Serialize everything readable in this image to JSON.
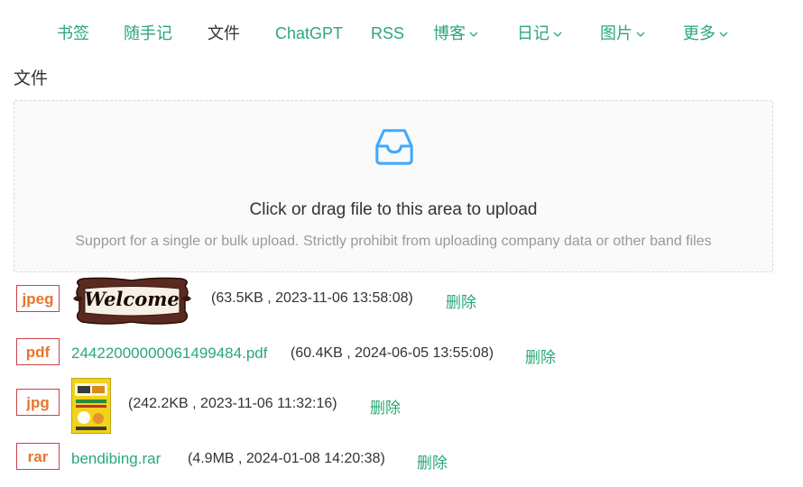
{
  "nav": {
    "items": [
      {
        "label": "书签"
      },
      {
        "label": "随手记"
      },
      {
        "label": "文件"
      },
      {
        "label": "ChatGPT"
      },
      {
        "label": "RSS"
      },
      {
        "label": "博客"
      },
      {
        "label": "日记"
      },
      {
        "label": "图片"
      },
      {
        "label": "更多"
      }
    ],
    "active_index": 2
  },
  "page": {
    "title": "文件"
  },
  "upload": {
    "icon": "inbox-icon",
    "hint": "Click or drag file to this area to upload",
    "sub": "Support for a single or bulk upload. Strictly prohibit from uploading company data or other band files"
  },
  "files": [
    {
      "type": "jpeg",
      "thumb_text": "Welcome",
      "meta": "(63.5KB , 2023-11-06 13:58:08)",
      "delete": "删除"
    },
    {
      "type": "pdf",
      "name": "24422000000061499484.pdf",
      "meta": "(60.4KB , 2024-06-05 13:55:08)",
      "delete": "删除"
    },
    {
      "type": "jpg",
      "meta": "(242.2KB , 2023-11-06 11:32:16)",
      "delete": "删除"
    },
    {
      "type": "rar",
      "name": "bendibing.rar",
      "meta": "(4.9MB , 2024-01-08 14:20:38)",
      "delete": "删除"
    }
  ],
  "colors": {
    "accent": "#2aa876",
    "badge_border": "#c8434a",
    "badge_text": "#e8762d",
    "icon_blue": "#40a9ff"
  }
}
